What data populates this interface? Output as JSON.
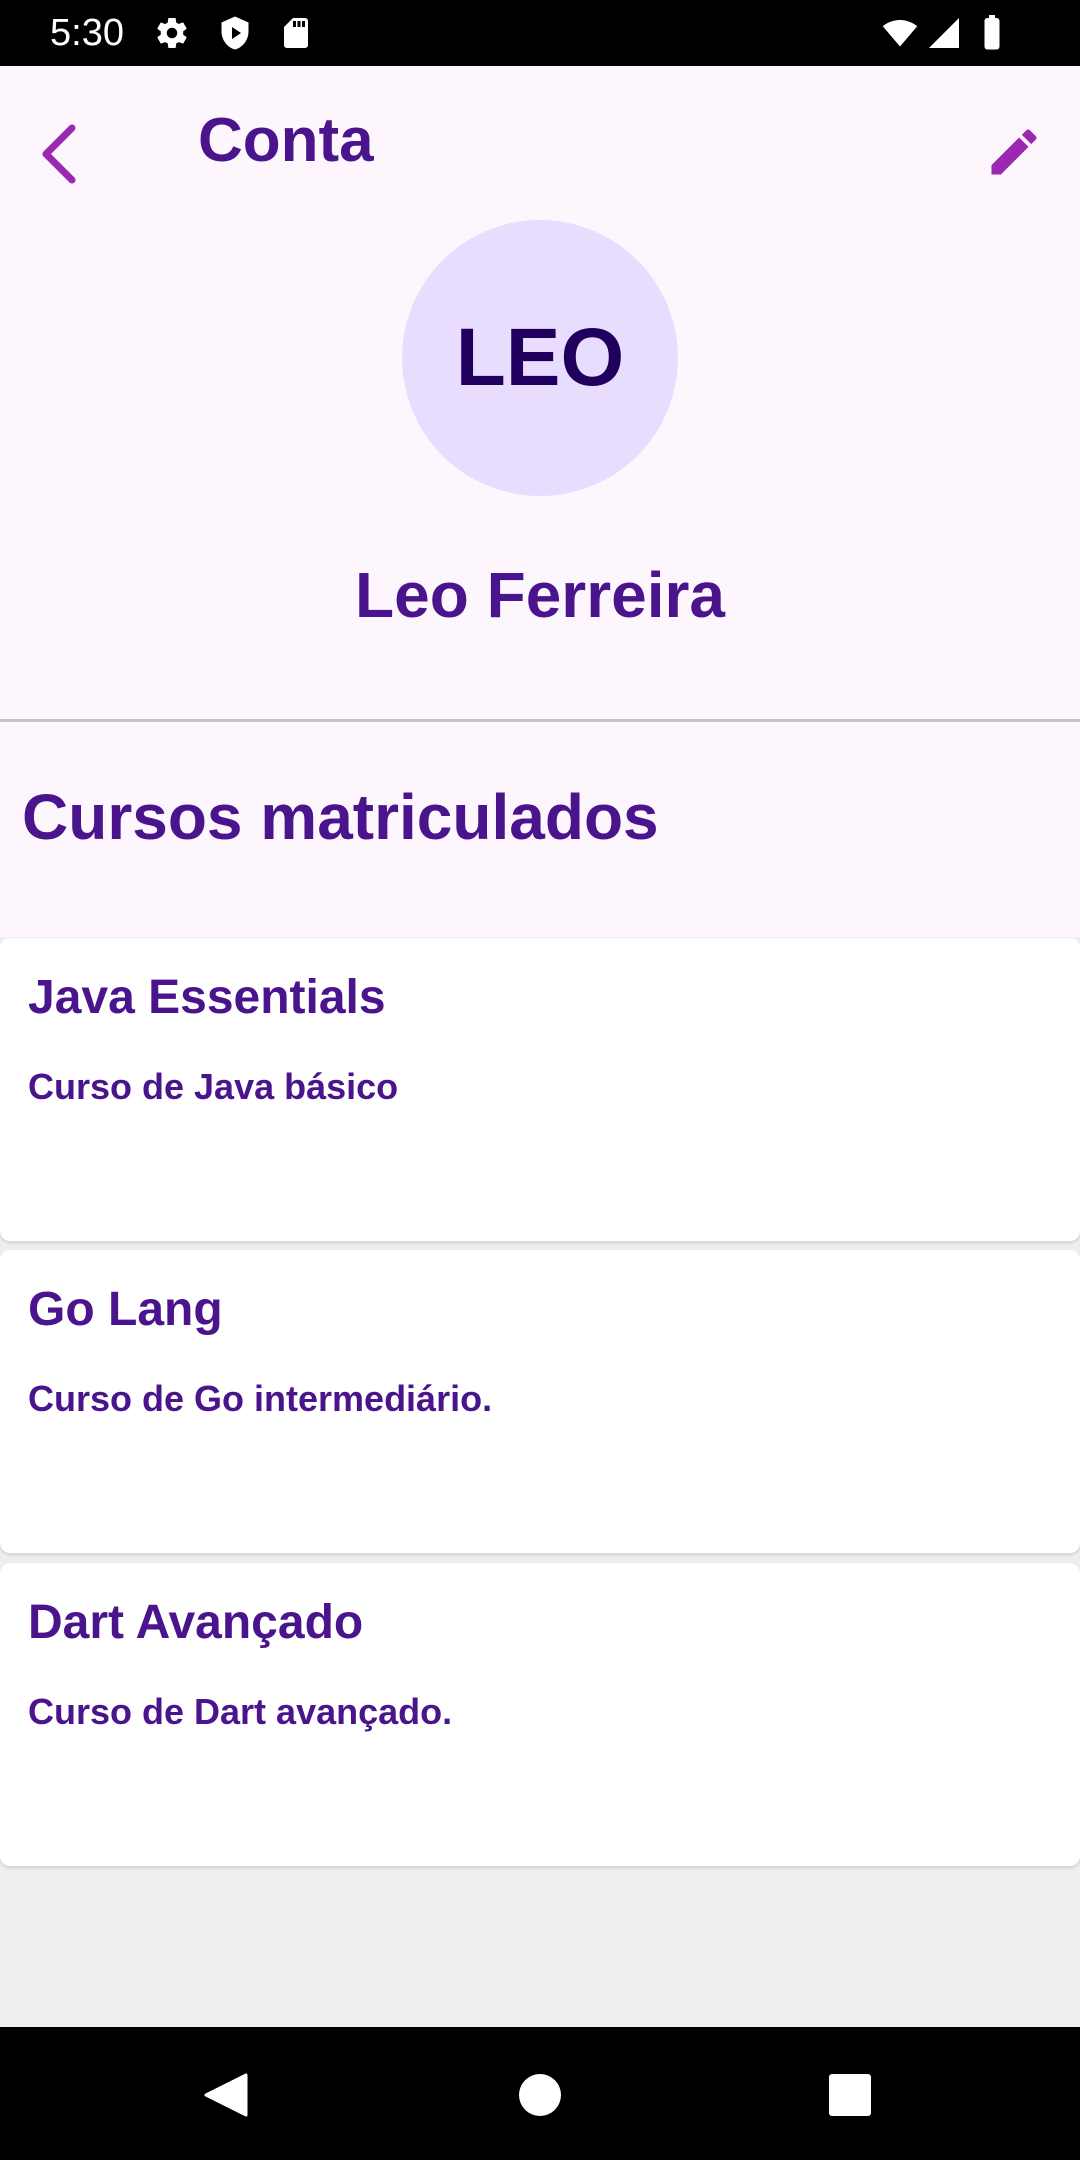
{
  "status_bar": {
    "time": "5:30",
    "left_icons": [
      "gear-icon",
      "shield-play-icon",
      "sd-card-icon"
    ],
    "right_icons": [
      "wifi-icon",
      "cell-signal-icon",
      "battery-icon"
    ]
  },
  "app_bar": {
    "title": "Conta",
    "back_icon": "chevron-left-icon",
    "edit_icon": "pencil-icon"
  },
  "profile": {
    "initials": "LEO",
    "name": "Leo Ferreira"
  },
  "courses": {
    "section_title": "Cursos matriculados",
    "items": [
      {
        "title": "Java Essentials",
        "description": "Curso de Java básico"
      },
      {
        "title": "Go Lang",
        "description": "Curso de Go intermediário."
      },
      {
        "title": "Dart Avançado",
        "description": "Curso de Dart avançado."
      }
    ]
  },
  "nav_bar": {
    "buttons": [
      "back-triangle-icon",
      "home-circle-icon",
      "recents-square-icon"
    ]
  },
  "colors": {
    "primary_text": "#4a148c",
    "accent": "#9c27b0",
    "avatar_bg": "#e9ddff",
    "avatar_text": "#21005d",
    "surface": "#fdf7fd",
    "card": "#ffffff",
    "background": "#eeeeee"
  }
}
